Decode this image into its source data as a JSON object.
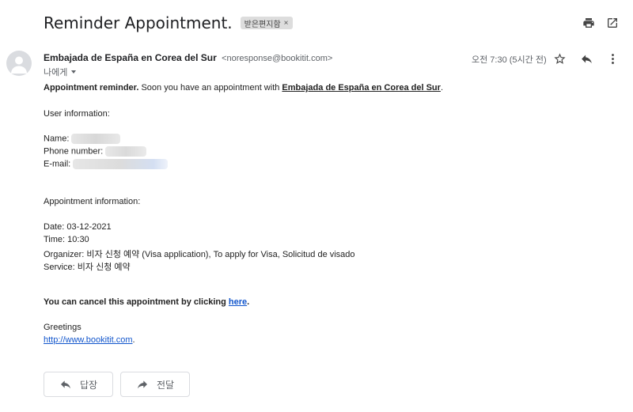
{
  "email": {
    "subject": "Reminder Appointment.",
    "label_chip": "받은편지함",
    "label_close": "×",
    "sender_name": "Embajada de España en Corea del Sur",
    "sender_email": "<noresponse@bookitit.com>",
    "to_me": "나에게",
    "timestamp": "오전 7:30 (5시간 전)"
  },
  "body": {
    "reminder_bold": "Appointment reminder.",
    "reminder_text": " Soon you have an appointment with ",
    "reminder_link": "Embajada de España en Corea del Sur",
    "reminder_end": ".",
    "user_info_heading": "User information:",
    "name_label": "Name:",
    "phone_label": "Phone number:",
    "email_label": "E-mail:",
    "appt_info_heading": "Appointment information:",
    "date": "Date: 03-12-2021",
    "time": "Time: 10:30",
    "organizer": "Organizer: 비자 신청 예약 (Visa application), To apply for Visa, Solicitud de visado",
    "service": "Service: 비자 신청 예약",
    "cancel_text": "You can cancel this appointment by clicking ",
    "cancel_link": "here",
    "cancel_end": ".",
    "greetings": "Greetings",
    "website": "http://www.bookitit.com",
    "website_end": "."
  },
  "actions": {
    "reply": "답장",
    "forward": "전달"
  },
  "icons": {
    "print": "printer-icon",
    "open_new_window": "open-in-new-icon",
    "star": "star-icon",
    "reply": "reply-icon",
    "more": "more-vertical-icon",
    "avatar": "person-icon"
  },
  "colors": {
    "link": "#1155cc",
    "chip": "#dddddd",
    "muted": "#5f6368"
  }
}
